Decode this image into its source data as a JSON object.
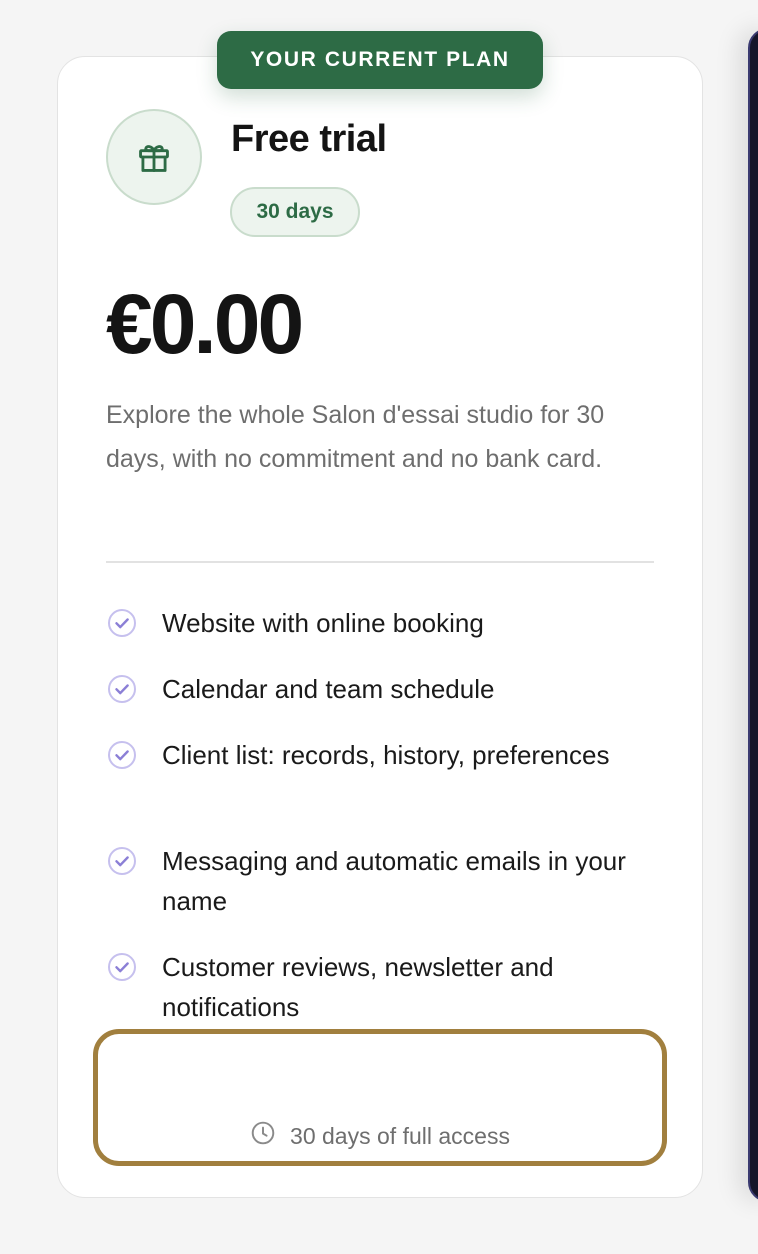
{
  "badge": {
    "label": "YOUR CURRENT PLAN"
  },
  "plan": {
    "icon": "gift-icon",
    "title": "Free trial",
    "duration_pill": "30 days",
    "price": "€0.00",
    "description": "Explore the whole Salon d'essai studio for 30 days, with no commitment and no bank card."
  },
  "features": [
    {
      "icon": "check-circle-icon",
      "text": "Website with online booking"
    },
    {
      "icon": "check-circle-icon",
      "text": "Calendar and team schedule"
    },
    {
      "icon": "check-circle-icon",
      "text": "Client list: records, history, preferences"
    },
    {
      "icon": "check-circle-icon",
      "text": "Messaging and automatic emails in your name"
    },
    {
      "icon": "check-circle-icon",
      "text": "Customer reviews, newsletter and notifications"
    }
  ],
  "footer": {
    "icon": "clock-icon",
    "text": "30 days of full access"
  },
  "colors": {
    "brand_green": "#2d6b45",
    "check_purple": "#8b7fd6",
    "highlight_border": "#a17f3e",
    "muted_text": "#6e6e6e"
  }
}
